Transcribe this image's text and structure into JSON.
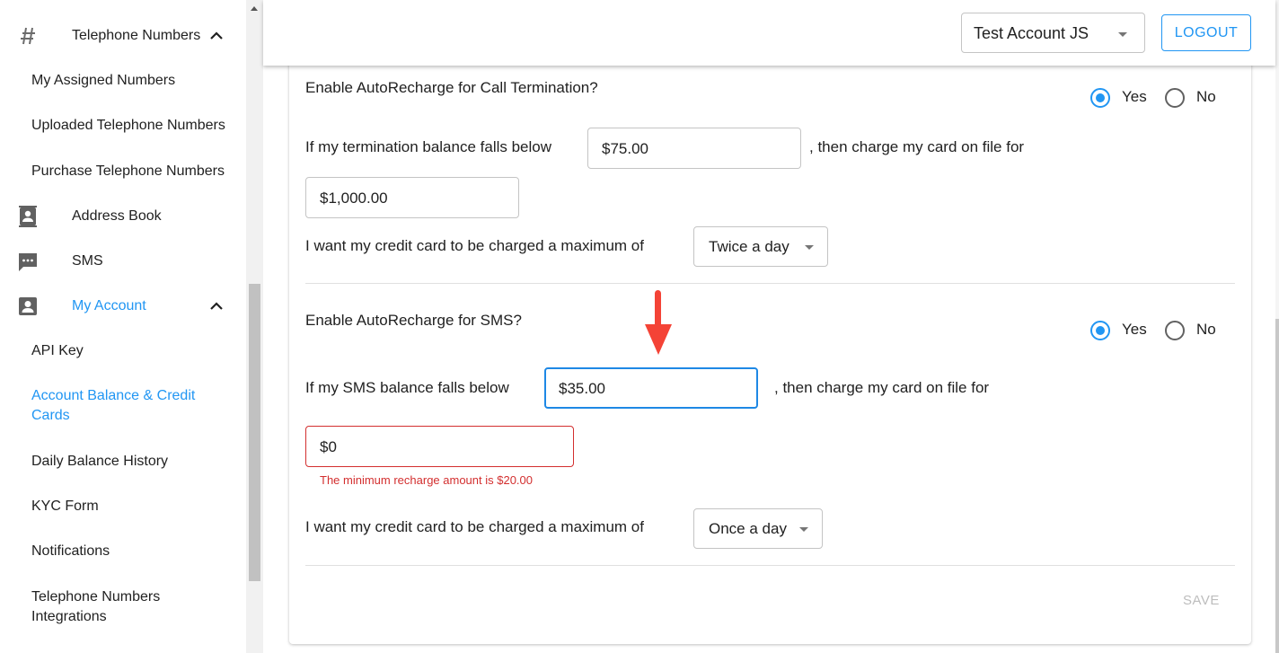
{
  "sidebar": {
    "telephone_numbers": {
      "label": "Telephone Numbers",
      "icon": "hash-icon"
    },
    "sub_telephone": [
      "My Assigned Numbers",
      "Uploaded Telephone Numbers",
      "Purchase Telephone Numbers"
    ],
    "address_book": {
      "label": "Address Book",
      "icon": "contacts-icon"
    },
    "sms": {
      "label": "SMS",
      "icon": "chat-icon"
    },
    "my_account": {
      "label": "My Account",
      "icon": "account-box-icon"
    },
    "sub_account": [
      "API Key",
      "Account Balance & Credit Cards",
      "Daily Balance History",
      "KYC Form",
      "Notifications",
      "Telephone Numbers Integrations"
    ],
    "active_item": "Account Balance & Credit Cards"
  },
  "header": {
    "account_select": "Test Account JS",
    "logout_label": "LOGOUT"
  },
  "termination": {
    "question": "Enable AutoRecharge for Call Termination?",
    "yes_label": "Yes",
    "no_label": "No",
    "selected": "Yes",
    "falls_below_text": "If my termination balance falls below",
    "threshold": "$75.00",
    "then_charge_text": ", then charge my card on file for",
    "charge_amount": "$1,000.00",
    "max_text": "I want my credit card to be charged a maximum of",
    "frequency": "Twice a day"
  },
  "sms": {
    "question": "Enable AutoRecharge for SMS?",
    "yes_label": "Yes",
    "no_label": "No",
    "selected": "Yes",
    "falls_below_text": "If my SMS balance falls below",
    "threshold": "$35.00",
    "then_charge_text": ", then charge my card on file for",
    "charge_amount": "$0",
    "error": "The minimum recharge amount is $20.00",
    "max_text": "I want my credit card to be charged a maximum of",
    "frequency": "Once a day"
  },
  "save_label": "SAVE",
  "colors": {
    "accent": "#2196f3",
    "error": "#d32f2f",
    "annotation_arrow": "#f44336"
  }
}
